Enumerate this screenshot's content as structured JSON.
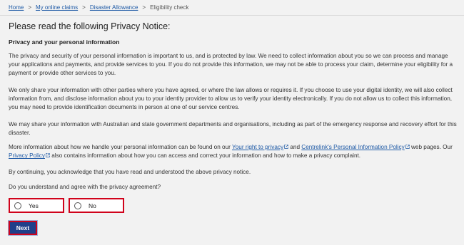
{
  "breadcrumb": {
    "items": [
      "Home",
      "My online claims",
      "Disaster Allowance"
    ],
    "separator": ">",
    "current": "Eligibility check"
  },
  "page_title": "Please read the following Privacy Notice:",
  "section_title": "Privacy and your personal information",
  "paragraphs": {
    "p1": "The privacy and security of your personal information is important to us, and is protected by law. We need to collect information about you so we can process and manage your applications and payments, and provide services to you. If you do not provide this information, we may not be able to process your claim, determine your eligibility for a payment or provide other services to you.",
    "p2": "We only share your information with other parties where you have agreed, or where the law allows or requires it. If you choose to use your digital identity, we will also collect information from, and disclose information about you to your identity provider to allow us to verify your identity electronically. If you do not allow us to collect this information, you may need to provide identification documents in person at one of our service centres.",
    "p3": "We may share your information with Australian and state government departments and organisations, including as part of the emergency response and recovery effort for this disaster.",
    "p4": {
      "text1": "More information about how we handle your personal information can be found on our ",
      "link1": "Your right to privacy",
      "text2": " and ",
      "link2": "Centrelink's Personal Information Policy",
      "text3": " web pages. Our ",
      "link3": "Privacy Policy",
      "text4": " also contains information about how you can access and correct your information and how to make a privacy complaint."
    },
    "p5": "By continuing, you acknowledge that you have read and understood the above privacy notice.",
    "question": "Do you understand and agree with the privacy agreement?"
  },
  "options": {
    "yes": "Yes",
    "no": "No"
  },
  "next_label": "Next",
  "colors": {
    "link": "#1f5aa6",
    "error_border": "#d0021b",
    "button": "#1f3f8a",
    "background": "#f2f2f2"
  },
  "icons": {
    "external_link": "external-link-icon",
    "radio": "radio-unselected"
  }
}
